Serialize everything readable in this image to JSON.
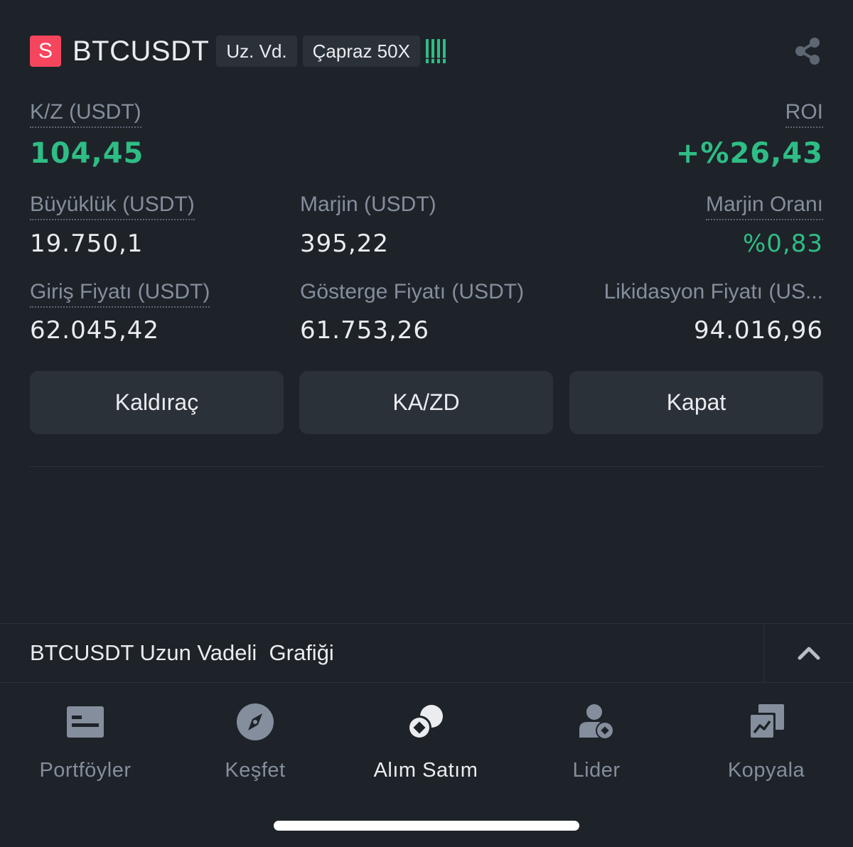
{
  "header": {
    "side_badge": "S",
    "symbol": "BTCUSDT",
    "contract_tag": "Uz. Vd.",
    "margin_mode_tag": "Çapraz 50X",
    "share_icon": "share-icon"
  },
  "pnl": {
    "label": "K/Z (USDT)",
    "value": "104,45"
  },
  "roi": {
    "label": "ROI",
    "value": "+%26,43"
  },
  "size": {
    "label": "Büyüklük (USDT)",
    "value": "19.750,1"
  },
  "margin": {
    "label": "Marjin (USDT)",
    "value": "395,22"
  },
  "margin_ratio": {
    "label": "Marjin Oranı",
    "value": "%0,83"
  },
  "entry_price": {
    "label": "Giriş Fiyatı (USDT)",
    "value": "62.045,42"
  },
  "mark_price": {
    "label": "Gösterge Fiyatı (USDT)",
    "value": "61.753,26"
  },
  "liq_price": {
    "label": "Likidasyon Fiyatı (US...",
    "value": "94.016,96"
  },
  "actions": {
    "leverage": "Kaldıraç",
    "tpsl": "KA/ZD",
    "close": "Kapat"
  },
  "chart_section": {
    "title": "BTCUSDT Uzun Vadeli  Grafiği",
    "toggle_icon": "chevron-up-icon"
  },
  "nav": [
    {
      "label": "Portföyler",
      "icon": "wallet-icon"
    },
    {
      "label": "Keşfet",
      "icon": "compass-icon"
    },
    {
      "label": "Alım Satım",
      "icon": "trade-icon"
    },
    {
      "label": "Lider",
      "icon": "leader-icon"
    },
    {
      "label": "Kopyala",
      "icon": "copy-trade-icon"
    }
  ],
  "colors": {
    "background": "#1e2329",
    "positive": "#2ebd85",
    "sell_badge": "#f6465d",
    "button": "#2b3139",
    "muted_text": "#848e9c"
  }
}
